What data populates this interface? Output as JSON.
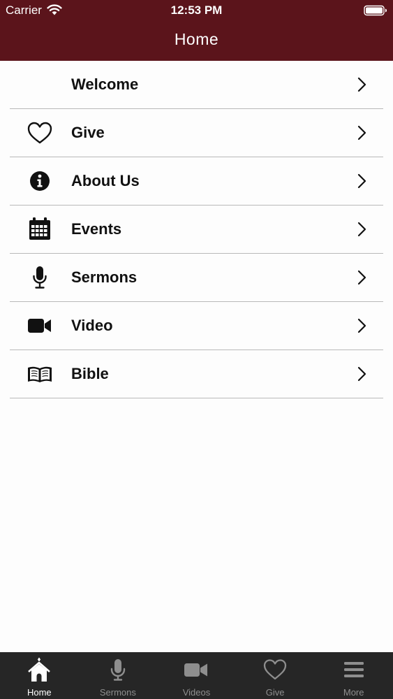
{
  "status_bar": {
    "carrier": "Carrier",
    "time": "12:53 PM",
    "icons": [
      "wifi-icon",
      "battery-icon"
    ]
  },
  "header": {
    "title": "Home",
    "color": "#5b141b"
  },
  "menu": {
    "items": [
      {
        "label": "Welcome",
        "icon": ""
      },
      {
        "label": "Give",
        "icon": "heart-icon"
      },
      {
        "label": "About Us",
        "icon": "info-icon"
      },
      {
        "label": "Events",
        "icon": "calendar-icon"
      },
      {
        "label": "Sermons",
        "icon": "microphone-icon"
      },
      {
        "label": "Video",
        "icon": "video-camera-icon"
      },
      {
        "label": "Bible",
        "icon": "bible-icon"
      }
    ],
    "chevron_icon": "chevron-right-icon"
  },
  "tabbar": {
    "active": "Home",
    "tabs": [
      {
        "label": "Home",
        "icon": "church-icon"
      },
      {
        "label": "Sermons",
        "icon": "microphone-icon"
      },
      {
        "label": "Videos",
        "icon": "video-camera-icon"
      },
      {
        "label": "Give",
        "icon": "heart-icon"
      },
      {
        "label": "More",
        "icon": "menu-icon"
      }
    ]
  }
}
